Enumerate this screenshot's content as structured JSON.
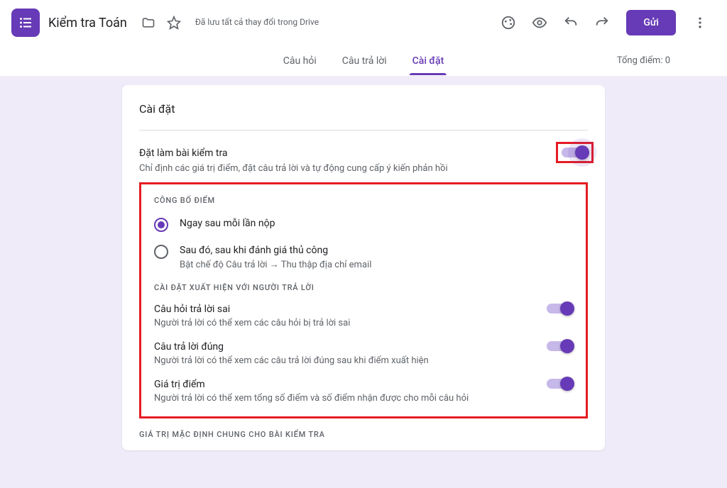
{
  "header": {
    "title": "Kiểm tra Toán",
    "save_status": "Đã lưu tất cả thay đổi trong Drive",
    "send_label": "Gửi"
  },
  "tabs": {
    "questions": "Câu hỏi",
    "responses": "Câu trả lời",
    "settings": "Cài đặt",
    "total_points": "Tổng điểm: 0"
  },
  "card": {
    "title": "Cài đặt",
    "quiz_heading": "Đặt làm bài kiểm tra",
    "quiz_sub": "Chỉ định các giá trị điểm, đặt câu trả lời và tự động cung cấp ý kiến phản hồi",
    "release_label": "CÔNG BỐ ĐIỂM",
    "radio1": "Ngay sau mỗi lần nộp",
    "radio2": "Sau đó, sau khi đánh giá thủ công",
    "radio2_sub": "Bật chế độ Câu trả lời → Thu thập địa chỉ email",
    "respondent_label": "CÀI ĐẶT XUẤT HIỆN VỚI NGƯỜI TRẢ LỜI",
    "opt1_h": "Câu hỏi trả lời sai",
    "opt1_s": "Người trả lời có thể xem các câu hỏi bị trả lời sai",
    "opt2_h": "Câu trả lời đúng",
    "opt2_s": "Người trả lời có thể xem các câu trả lời đúng sau khi điểm xuất hiện",
    "opt3_h": "Giá trị điểm",
    "opt3_s": "Người trả lời có thể xem tổng số điểm và số điểm nhận được cho mỗi câu hỏi",
    "defaults_label": "GIÁ TRỊ MẶC ĐỊNH CHUNG CHO BÀI KIỂM TRA"
  }
}
